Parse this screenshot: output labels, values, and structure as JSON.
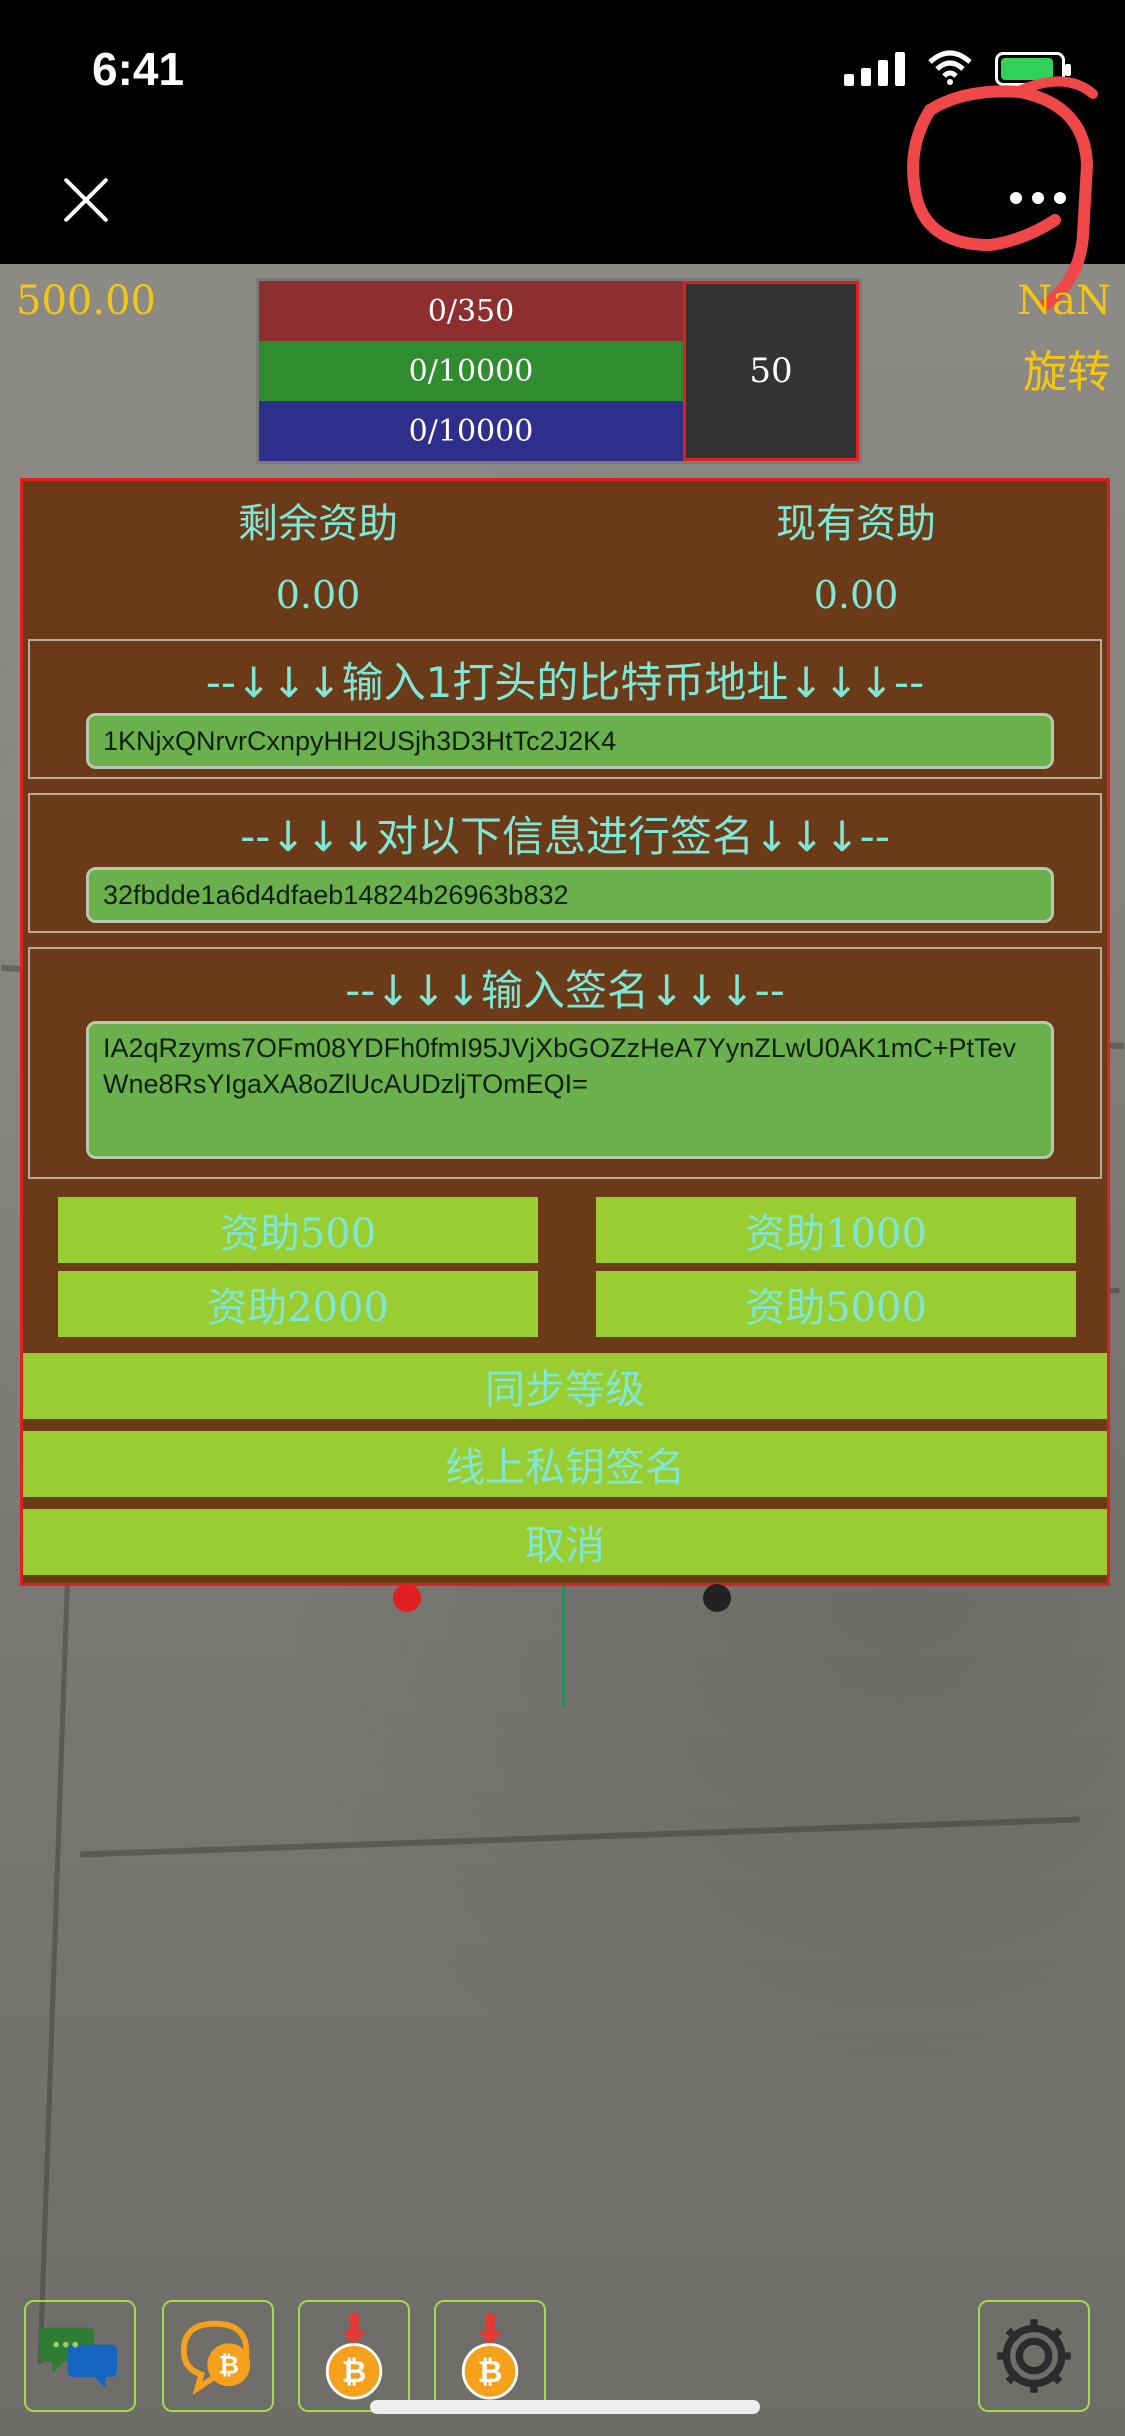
{
  "status_bar": {
    "time": "6:41"
  },
  "nav": {
    "close_icon": "close-icon",
    "more_icon": "more-dots-icon"
  },
  "hud": {
    "balance": "500.00",
    "nan": "NaN",
    "rotate": "旋转",
    "bars": [
      "0/350",
      "0/10000",
      "0/10000"
    ],
    "level": "50"
  },
  "panel": {
    "remaining_label": "剩余资助",
    "remaining_value": "0.00",
    "current_label": "现有资助",
    "current_value": "0.00",
    "address_title": "--↓↓↓输入1打头的比特币地址↓↓↓--",
    "address_value": "1KNjxQNrvrCxnpyHH2USjh3D3HtTc2J2K4",
    "message_title": "--↓↓↓对以下信息进行签名↓↓↓--",
    "message_value": "32fbdde1a6d4dfaeb14824b26963b832",
    "signature_title": "--↓↓↓输入签名↓↓↓--",
    "signature_value": "IA2qRzyms7OFm08YDFh0fmI95JVjXbGOZzHeA7YynZLwU0AK1mC+PtTevWne8RsYIgaXA8oZlUcAUDzljTOmEQI=",
    "buttons": {
      "b500": "资助500",
      "b1000": "资助1000",
      "b2000": "资助2000",
      "b5000": "资助5000",
      "sync": "同步等级",
      "sign": "线上私钥签名",
      "cancel": "取消"
    }
  },
  "bottom": {
    "chat_icon": "chat-bubbles-icon",
    "coin_chat_icon": "bitcoin-chat-icon",
    "coin_download_icon": "bitcoin-download-icon",
    "settings_icon": "gear-icon"
  },
  "colors": {
    "accent_text": "#7fe7d5",
    "panel_bg": "#6b3a19",
    "button_bg": "#9acd32",
    "hud_gold": "#f3c613",
    "border_red": "#e02020"
  }
}
